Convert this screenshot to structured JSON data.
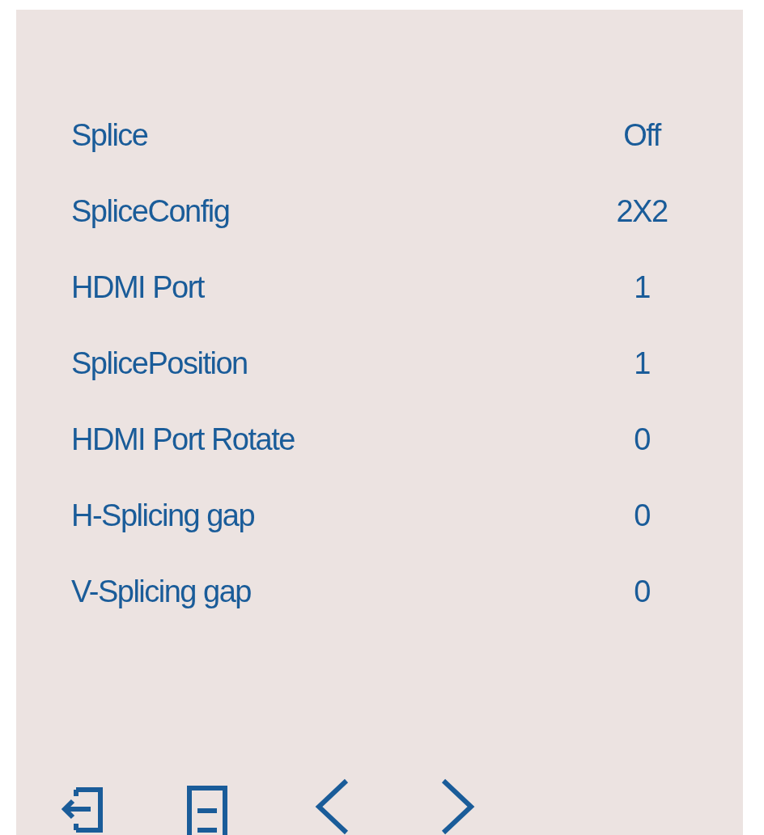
{
  "menu": {
    "rows": [
      {
        "label": "Splice",
        "value": "Off"
      },
      {
        "label": "SpliceConfig",
        "value": "2X2"
      },
      {
        "label": "HDMI Port",
        "value": "1"
      },
      {
        "label": "SplicePosition",
        "value": "1"
      },
      {
        "label": "HDMI Port Rotate",
        "value": "0"
      },
      {
        "label": "H-Splicing gap",
        "value": "0"
      },
      {
        "label": "V-Splicing gap",
        "value": "0"
      }
    ],
    "nav_icons": [
      {
        "kind": "exit"
      },
      {
        "kind": "menu"
      },
      {
        "kind": "prev"
      },
      {
        "kind": "next"
      }
    ]
  }
}
